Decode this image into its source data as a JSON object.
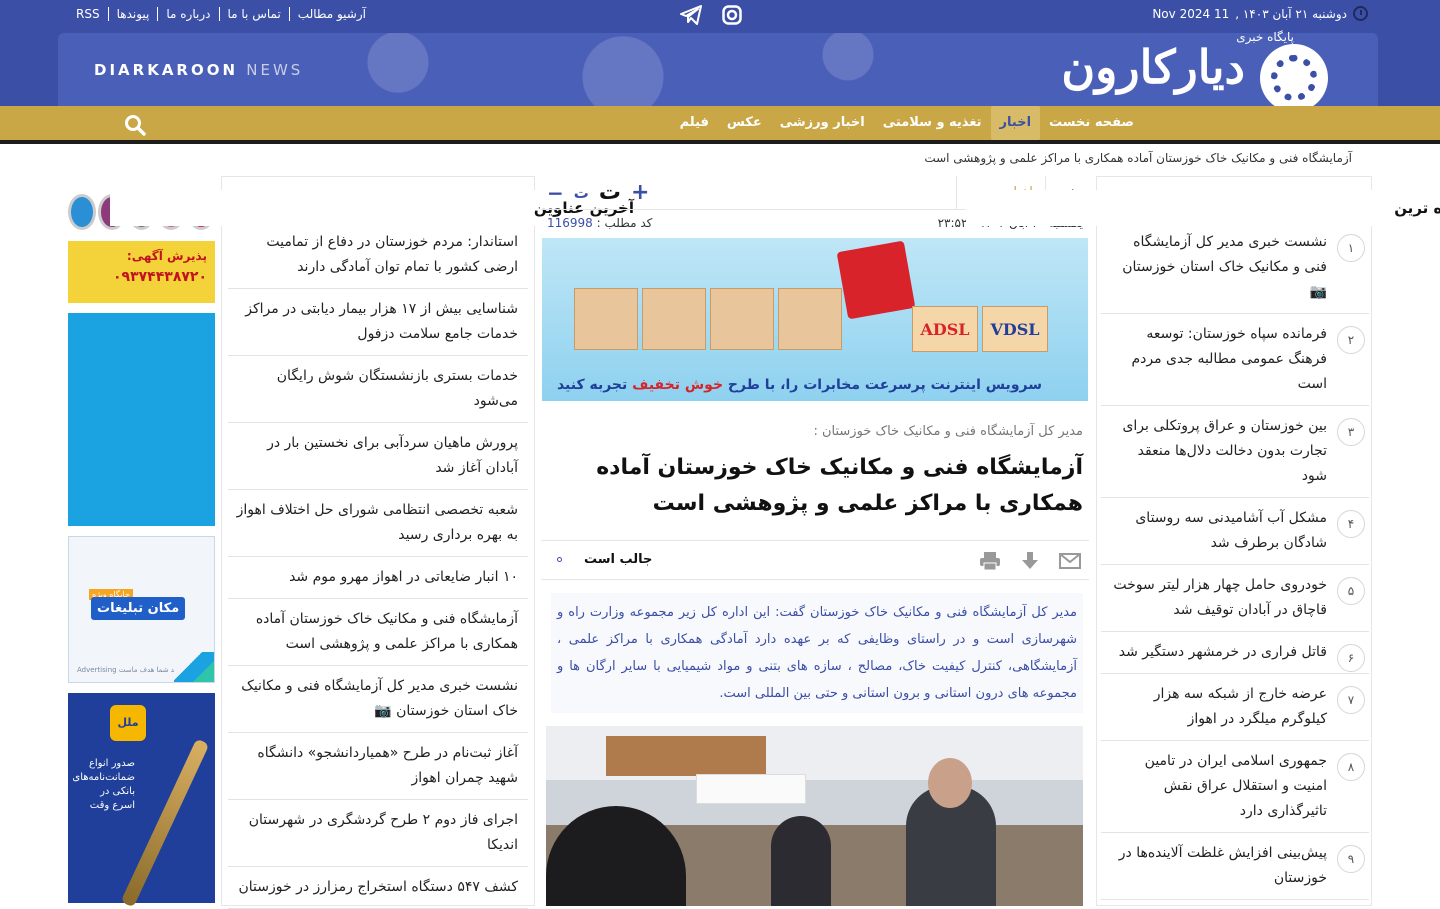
{
  "topbar": {
    "date_fa": "دوشنبه ۲۱ آبان ۱۴۰۳ ,",
    "date_en": "11 Nov 2024",
    "links": [
      "RSS",
      "پیوندها",
      "درباره ما",
      "تماس با ما",
      "آرشیو مطالب"
    ]
  },
  "brand": {
    "en_name": "DIARKAROON",
    "en_news": "NEWS",
    "fa_name": "دیارکارون",
    "fa_sub": "پایگاه خبری"
  },
  "nav": {
    "items": [
      "صفحه نخست",
      "اخبار",
      "تغذیه و سلامتی",
      "اخبار ورزشی",
      "عکس",
      "فیلم"
    ],
    "active_index": 1
  },
  "breadcrumb": "آزمایشگاه فنی و مکانیک خاک خوزستان آماده همکاری با مراکز علمی و پژوهشی است",
  "ads": {
    "phone_title": "پذیرش آگهی:",
    "phone_number": "۰۹۳۷۴۴۳۸۷۲۰",
    "space_tag": "مکان تبلیغات",
    "space_badge": "جایگاه ویژه",
    "space_note": "معرفی برند شما هدف ماست",
    "space_note_en": "Advertising",
    "bank_badge": "ملل",
    "bank_text": "صدور انواع ضمانت‌نامه‌های بانکی در اسرع وقت"
  },
  "latest": {
    "title": "آخرین عناوین",
    "items": [
      "استاندار: مردم خوزستان در دفاع از تمامیت ارضی کشور با تمام توان آمادگی دارند",
      "شناسایی بیش از ۱۷ هزار بیمار دیابتی در مراکز خدمات جامع سلامت دزفول",
      "خدمات بستری بازنشستگان شوش رایگان می‌شود",
      "پرورش ماهیان سردآبی برای نخستین بار در آبادان آغاز شد",
      "شعبه تخصصی انتظامی شورای حل اختلاف اهواز به بهره برداری رسید",
      "۱۰ انبار ضایعاتی در اهواز مهرو موم شد",
      "آزمایشگاه فنی و مکانیک خاک خوزستان آماده همکاری با مراکز علمی و پژوهشی است",
      "نشست خبری مدیر کل آزمایشگاه فنی و مکانیک خاک استان خوزستان 📷",
      "آغاز ثبت‌نام در طرح «همیاردانشجو» دانشگاه شهید چمران اهواز",
      "اجرای فاز دوم ۲ طرح گردشگری در شهرستان اندیکا",
      "کشف ۵۴۷ دستگاه استخراج رمزارز در خوزستان"
    ]
  },
  "popular": {
    "title": "پربیننده ترین",
    "items": [
      {
        "num": "۱",
        "text": "نشست خبری مدیر کل آزمایشگاه فنی و مکانیک خاک استان خوزستان 📷"
      },
      {
        "num": "۲",
        "text": "فرمانده سپاه خوزستان: توسعه فرهنگ عمومی مطالبه جدی مردم است"
      },
      {
        "num": "۳",
        "text": "بین خوزستان و عراق پروتکلی برای تجارت بدون دخالت دلال‌ها منعقد شود"
      },
      {
        "num": "۴",
        "text": "مشکل آب آشامیدنی سه روستای شادگان برطرف شد"
      },
      {
        "num": "۵",
        "text": "خودروی حامل چهار هزار لیتر سوخت قاچاق در آبادان توقیف شد"
      },
      {
        "num": "۶",
        "text": "قاتل فراری در خرمشهر دستگیر شد"
      },
      {
        "num": "۷",
        "text": "عرضه خارج از شبکه سه هزار کیلوگرم میلگرد در اهواز"
      },
      {
        "num": "۸",
        "text": "جمهوری اسلامی ایران در تامین امنیت و استقلال عراق نقش تاثیرگذاری دارد"
      },
      {
        "num": "۹",
        "text": "پیش‌بینی افزایش غلظت آلاینده‌ها در خوزستان"
      }
    ]
  },
  "article": {
    "cat1": "خبر",
    "cat2": "اخبار",
    "font_plus": "+",
    "font_big": "ت",
    "font_small": "ت",
    "font_minus": "−",
    "date": "یکشنبه ۲۰ آبان ۱۴۰۳ - ۲۳:۵۲",
    "code_label": "کد مطلب :",
    "code": "116998",
    "banner_lbl1": "ADSL",
    "banner_lbl2": "VDSL",
    "banner_text_a": "سرویس اینترنت پرسرعت مخابرات را، با طرح",
    "banner_text_b": "خوش",
    "banner_text_c": "تخفیف",
    "banner_text_d": "تجربه کنید",
    "lead_label": "مدیر کل آزمایشگاه فنی و مکانیک خاک خوزستان :",
    "title": "آزمایشگاه فنی و مکانیک خاک خوزستان آماده همکاری با مراکز علمی و پژوهشی است",
    "interesting": "جالب است",
    "lead": "مدیر کل آزمایشگاه فنی و مکانیک خاک خوزستان گفت: این اداره کل زیر مجموعه وزارت راه و شهرسازی است و در راستای وظایفی که بر عهده دارد آمادگی همکاری با مراکز علمی ، آزمایشگاهی، کنترل کیفیت خاک، مصالح ، سازه های بتنی و مواد شیمیایی با سایر ارگان ها و مجموعه های درون استانی و برون استانی و حتی بین المللی است."
  },
  "colors": {
    "brand_blue": "#3c4fa6",
    "nav_gold": "#c9a646"
  }
}
